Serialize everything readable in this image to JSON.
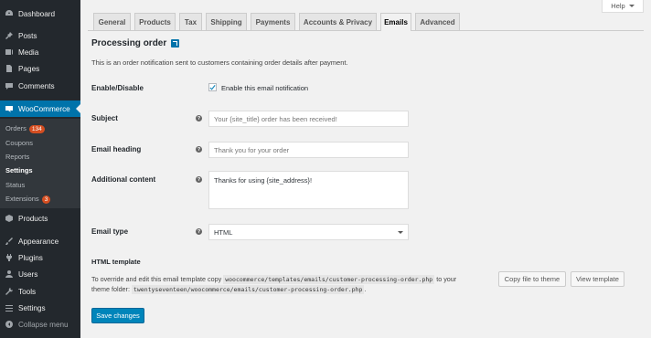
{
  "sidebar": {
    "items": [
      {
        "label": "Dashboard",
        "icon": "dashboard-icon"
      },
      {
        "label": "Posts",
        "icon": "pin-icon"
      },
      {
        "label": "Media",
        "icon": "media-icon"
      },
      {
        "label": "Pages",
        "icon": "page-icon"
      },
      {
        "label": "Comments",
        "icon": "comment-icon"
      },
      {
        "label": "WooCommerce",
        "icon": "woocommerce-icon"
      },
      {
        "label": "Products",
        "icon": "products-icon"
      },
      {
        "label": "Appearance",
        "icon": "brush-icon"
      },
      {
        "label": "Plugins",
        "icon": "plugin-icon"
      },
      {
        "label": "Users",
        "icon": "users-icon"
      },
      {
        "label": "Tools",
        "icon": "wrench-icon"
      },
      {
        "label": "Settings",
        "icon": "settings-icon"
      },
      {
        "label": "Collapse menu",
        "icon": "collapse-icon"
      }
    ],
    "submenu": [
      {
        "label": "Orders",
        "badge": "134"
      },
      {
        "label": "Coupons"
      },
      {
        "label": "Reports"
      },
      {
        "label": "Settings",
        "current": true
      },
      {
        "label": "Status"
      },
      {
        "label": "Extensions",
        "badge": "3"
      }
    ]
  },
  "help": {
    "label": "Help"
  },
  "tabs": [
    "General",
    "Products",
    "Tax",
    "Shipping",
    "Payments",
    "Accounts & Privacy",
    "Emails",
    "Advanced"
  ],
  "active_tab": "Emails",
  "section": {
    "title": "Processing order",
    "description": "This is an order notification sent to customers containing order details after payment."
  },
  "form": {
    "enable": {
      "label": "Enable/Disable",
      "checkbox_label": "Enable this email notification",
      "checked": true
    },
    "subject": {
      "label": "Subject",
      "placeholder": "Your {site_title} order has been received!"
    },
    "heading": {
      "label": "Email heading",
      "placeholder": "Thank you for your order"
    },
    "additional": {
      "label": "Additional content",
      "value": "Thanks for using {site_address}!"
    },
    "email_type": {
      "label": "Email type",
      "value": "HTML"
    }
  },
  "template": {
    "heading": "HTML template",
    "text_before": "To override and edit this email template copy",
    "path_plugin": "woocommerce/templates/emails/customer-processing-order.php",
    "text_mid": "to your",
    "text_line2": "theme folder:",
    "path_theme": "twentyseventeen/woocommerce/emails/customer-processing-order.php",
    "text_end": ".",
    "copy_button": "Copy file to theme",
    "view_button": "View template"
  },
  "save_button": "Save changes",
  "colors": {
    "sidebar_bg": "#23282d",
    "accent": "#0073aa",
    "primary_button": "#0085ba",
    "badge": "#d54e21"
  }
}
